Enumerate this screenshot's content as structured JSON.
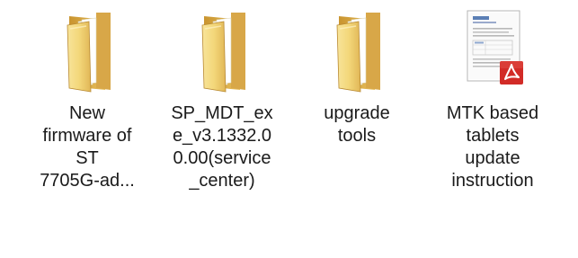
{
  "desktop": {
    "items": [
      {
        "type": "folder",
        "icon": "folder-icon",
        "label": "New\nfirmware of\nST\n7705G-ad..."
      },
      {
        "type": "folder",
        "icon": "folder-icon",
        "label": "SP_MDT_ex\ne_v3.1332.0\n0.00(service\n_center)"
      },
      {
        "type": "folder",
        "icon": "folder-icon",
        "label": "upgrade\ntools"
      },
      {
        "type": "pdf",
        "icon": "pdf-file-icon",
        "label": "MTK based\ntablets\nupdate\ninstruction"
      }
    ]
  },
  "colors": {
    "folder_front": "#f3d77a",
    "folder_back": "#e4b84e",
    "pdf_badge": "#d22b27"
  }
}
